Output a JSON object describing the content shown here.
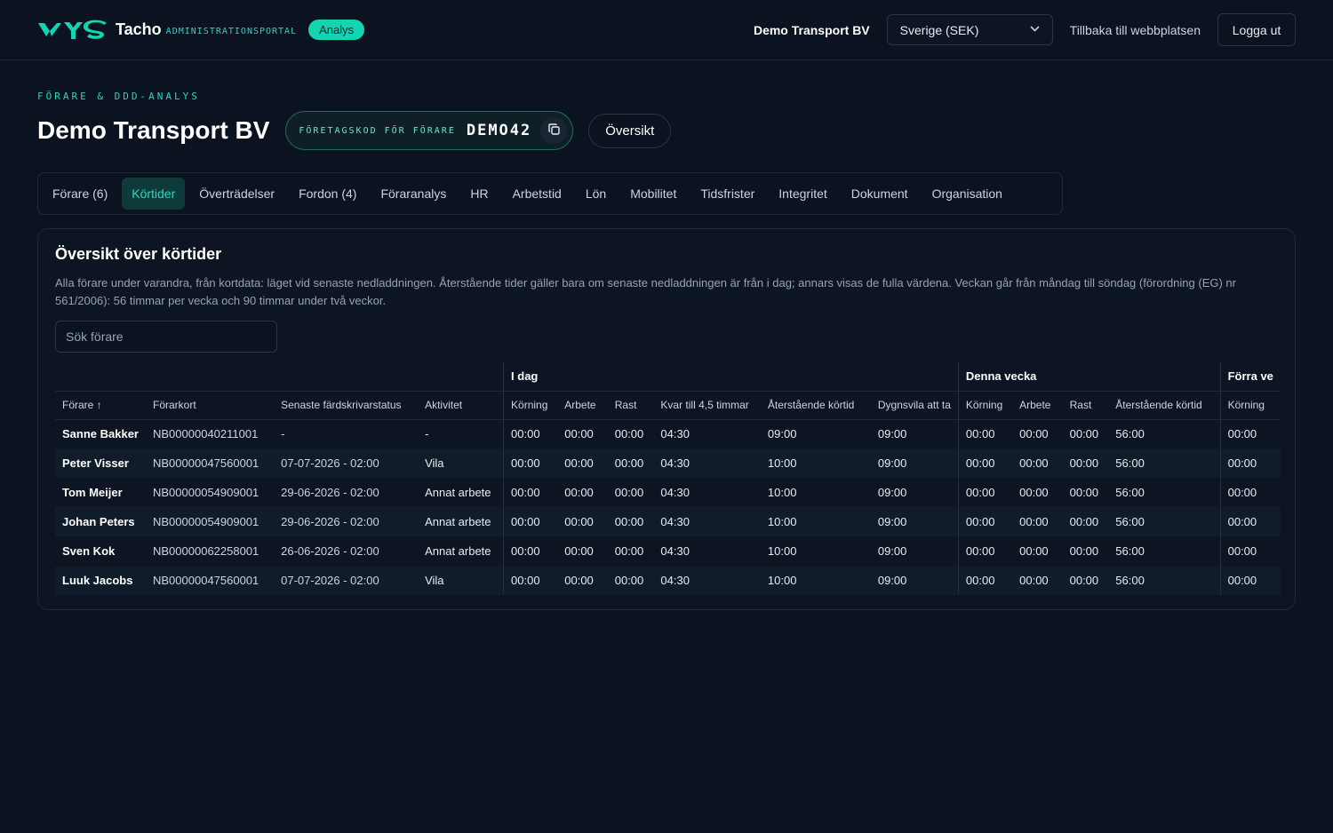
{
  "header": {
    "brand": "Tacho",
    "brand_sub": "ADMINISTRATIONSPORTAL",
    "badge": "Analys",
    "company": "Demo Transport BV",
    "country": "Sverige (SEK)",
    "back_link": "Tillbaka till webbplatsen",
    "logout": "Logga ut"
  },
  "page": {
    "eyebrow": "FÖRARE & DDD-ANALYS",
    "title": "Demo Transport BV",
    "code_label": "FÖRETAGSKOD FÖR FÖRARE",
    "code_value": "DEMO42",
    "overview_button": "Översikt"
  },
  "tabs": [
    {
      "label": "Förare (6)"
    },
    {
      "label": "Körtider"
    },
    {
      "label": "Överträdelser"
    },
    {
      "label": "Fordon (4)"
    },
    {
      "label": "Föraranalys"
    },
    {
      "label": "HR"
    },
    {
      "label": "Arbetstid"
    },
    {
      "label": "Lön"
    },
    {
      "label": "Mobilitet"
    },
    {
      "label": "Tidsfrister"
    },
    {
      "label": "Integritet"
    },
    {
      "label": "Dokument"
    },
    {
      "label": "Organisation"
    }
  ],
  "card": {
    "title": "Översikt över körtider",
    "description": "Alla förare under varandra, från kortdata: läget vid senaste nedladdningen. Återstående tider gäller bara om senaste nedladdningen är från i dag; annars visas de fulla värdena. Veckan går från måndag till söndag (förordning (EG) nr 561/2006): 56 timmar per vecka och 90 timmar under två veckor.",
    "search_placeholder": "Sök förare"
  },
  "table": {
    "groups": {
      "today": "I dag",
      "this_week": "Denna vecka",
      "prev_week": "Förra ve"
    },
    "columns": {
      "driver": "Förare ↑",
      "card": "Förarkort",
      "status": "Senaste färdskrivarstatus",
      "activity": "Aktivitet",
      "t_drive": "Körning",
      "t_work": "Arbete",
      "t_rest": "Rast",
      "t_left45": "Kvar till 4,5 timmar",
      "t_remaining": "Återstående körtid",
      "t_dailyrest": "Dygnsvila att ta",
      "w_drive": "Körning",
      "w_work": "Arbete",
      "w_rest": "Rast",
      "w_remaining": "Återstående körtid",
      "p_drive": "Körning"
    },
    "rows": [
      {
        "driver": "Sanne Bakker",
        "card": "NB00000040211001",
        "status": "-",
        "activity": "-",
        "t_drive": "00:00",
        "t_work": "00:00",
        "t_rest": "00:00",
        "t_left45": "04:30",
        "t_remaining": "09:00",
        "t_dailyrest": "09:00",
        "w_drive": "00:00",
        "w_work": "00:00",
        "w_rest": "00:00",
        "w_remaining": "56:00",
        "p_drive": "00:00"
      },
      {
        "driver": "Peter Visser",
        "card": "NB00000047560001",
        "status": "07-07-2026 - 02:00",
        "activity": "Vila",
        "t_drive": "00:00",
        "t_work": "00:00",
        "t_rest": "00:00",
        "t_left45": "04:30",
        "t_remaining": "10:00",
        "t_dailyrest": "09:00",
        "w_drive": "00:00",
        "w_work": "00:00",
        "w_rest": "00:00",
        "w_remaining": "56:00",
        "p_drive": "00:00"
      },
      {
        "driver": "Tom Meijer",
        "card": "NB00000054909001",
        "status": "29-06-2026 - 02:00",
        "activity": "Annat arbete",
        "t_drive": "00:00",
        "t_work": "00:00",
        "t_rest": "00:00",
        "t_left45": "04:30",
        "t_remaining": "10:00",
        "t_dailyrest": "09:00",
        "w_drive": "00:00",
        "w_work": "00:00",
        "w_rest": "00:00",
        "w_remaining": "56:00",
        "p_drive": "00:00"
      },
      {
        "driver": "Johan Peters",
        "card": "NB00000054909001",
        "status": "29-06-2026 - 02:00",
        "activity": "Annat arbete",
        "t_drive": "00:00",
        "t_work": "00:00",
        "t_rest": "00:00",
        "t_left45": "04:30",
        "t_remaining": "10:00",
        "t_dailyrest": "09:00",
        "w_drive": "00:00",
        "w_work": "00:00",
        "w_rest": "00:00",
        "w_remaining": "56:00",
        "p_drive": "00:00"
      },
      {
        "driver": "Sven Kok",
        "card": "NB00000062258001",
        "status": "26-06-2026 - 02:00",
        "activity": "Annat arbete",
        "t_drive": "00:00",
        "t_work": "00:00",
        "t_rest": "00:00",
        "t_left45": "04:30",
        "t_remaining": "10:00",
        "t_dailyrest": "09:00",
        "w_drive": "00:00",
        "w_work": "00:00",
        "w_rest": "00:00",
        "w_remaining": "56:00",
        "p_drive": "00:00"
      },
      {
        "driver": "Luuk Jacobs",
        "card": "NB00000047560001",
        "status": "07-07-2026 - 02:00",
        "activity": "Vila",
        "t_drive": "00:00",
        "t_work": "00:00",
        "t_rest": "00:00",
        "t_left45": "04:30",
        "t_remaining": "10:00",
        "t_dailyrest": "09:00",
        "w_drive": "00:00",
        "w_work": "00:00",
        "w_rest": "00:00",
        "w_remaining": "56:00",
        "p_drive": "00:00"
      }
    ]
  },
  "colors": {
    "background": "#0b1220",
    "accent": "#2dd4bf",
    "badge": "#14d4b4",
    "active_tab_bg": "#0f3a3a"
  }
}
